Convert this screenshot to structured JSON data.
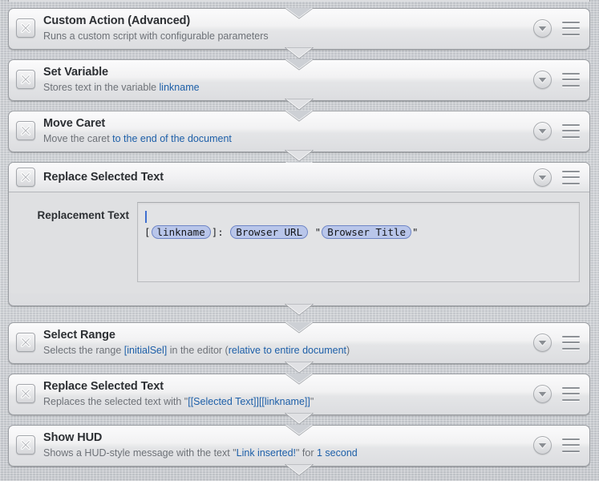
{
  "window": {
    "title": "Macro Actions",
    "background_color": "#c9ccd1"
  },
  "colors": {
    "accent_blue": "#1d5fa8",
    "token_fill": "#b9c6ea",
    "token_border": "#6f86c6",
    "card_border": "#9a9da2",
    "title_text": "#2c2f33",
    "desc_text": "#6d7177",
    "caret": "#3f6fd0"
  },
  "icons": {
    "disable": "x-icon",
    "disclosure": "chevron-down-icon",
    "menu": "hamburger-menu-icon"
  },
  "actions": [
    {
      "title": "Custom Action (Advanced)",
      "desc_parts": [
        {
          "text": "Runs a custom script with configurable parameters",
          "style": "gray"
        }
      ],
      "expanded": false
    },
    {
      "title": "Set Variable",
      "desc_parts": [
        {
          "text": "Stores text in the variable ",
          "style": "gray"
        },
        {
          "text": "linkname",
          "style": "blue"
        }
      ],
      "expanded": false
    },
    {
      "title": "Move Caret",
      "desc_parts": [
        {
          "text": "Move the caret ",
          "style": "gray"
        },
        {
          "text": "to the end of the document",
          "style": "blue"
        }
      ],
      "expanded": false
    },
    {
      "title": "Replace Selected Text",
      "desc_parts": [],
      "expanded": true,
      "body": {
        "field_label": "Replacement Text",
        "lines": [
          {
            "type": "caret"
          },
          {
            "type": "content",
            "parts": [
              {
                "kind": "text",
                "text": "["
              },
              {
                "kind": "token",
                "text": "linkname"
              },
              {
                "kind": "text",
                "text": "]: "
              },
              {
                "kind": "token",
                "text": "Browser URL"
              },
              {
                "kind": "text",
                "text": " \""
              },
              {
                "kind": "token",
                "text": "Browser Title"
              },
              {
                "kind": "text",
                "text": "\""
              }
            ]
          }
        ]
      }
    },
    {
      "title": "Select Range",
      "desc_parts": [
        {
          "text": "Selects the range ",
          "style": "gray"
        },
        {
          "text": "[initialSel]",
          "style": "blue"
        },
        {
          "text": " in the editor (",
          "style": "gray"
        },
        {
          "text": "relative to entire document",
          "style": "blue"
        },
        {
          "text": ")",
          "style": "gray"
        }
      ],
      "expanded": false
    },
    {
      "title": "Replace Selected Text",
      "desc_parts": [
        {
          "text": "Replaces the selected text with \"",
          "style": "gray"
        },
        {
          "text": "[[Selected Text]][[linkname]]",
          "style": "blue"
        },
        {
          "text": "\"",
          "style": "gray"
        }
      ],
      "expanded": false
    },
    {
      "title": "Show HUD",
      "desc_parts": [
        {
          "text": "Shows a HUD-style message with the text \"",
          "style": "gray"
        },
        {
          "text": "Link inserted!",
          "style": "blue"
        },
        {
          "text": "\" for ",
          "style": "gray"
        },
        {
          "text": "1 second",
          "style": "blue"
        }
      ],
      "expanded": false
    }
  ],
  "layout": {
    "card_tops": [
      10,
      74,
      138,
      202,
      402,
      466,
      530
    ],
    "card_heights": [
      52,
      52,
      52,
      180,
      52,
      52,
      52
    ]
  }
}
